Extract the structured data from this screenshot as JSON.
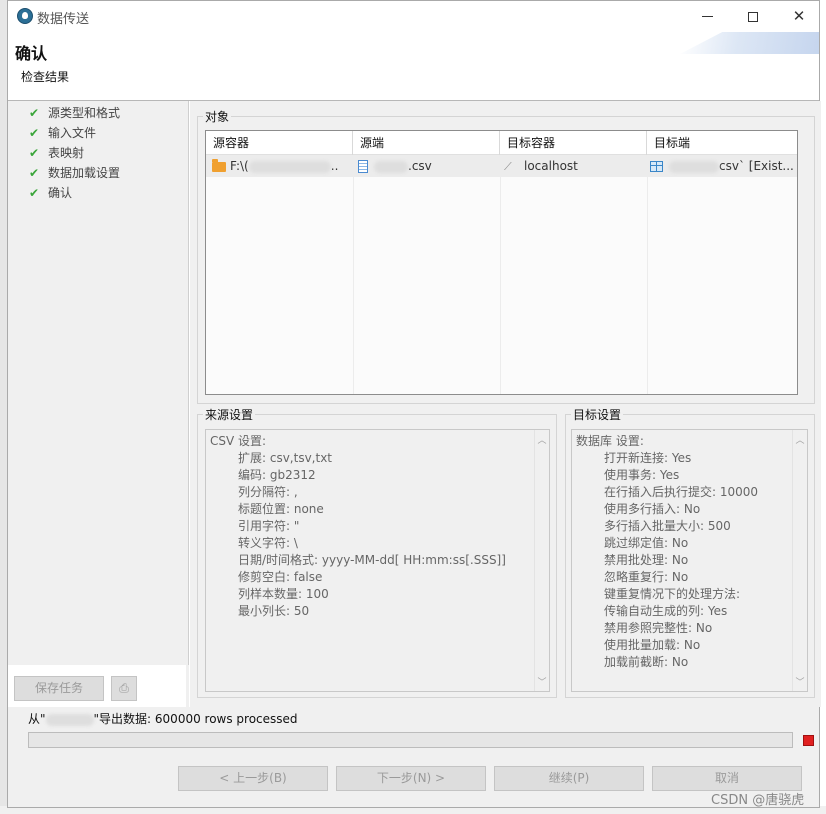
{
  "window": {
    "title": "数据传送",
    "minimize_icon": "minimize-icon",
    "maximize_icon": "maximize-icon",
    "close_icon": "close-icon"
  },
  "header": {
    "title": "确认",
    "description": "检查结果"
  },
  "steps": [
    {
      "label": "源类型和格式",
      "icon": "check-icon"
    },
    {
      "label": "输入文件",
      "icon": "check-icon"
    },
    {
      "label": "表映射",
      "icon": "check-icon"
    },
    {
      "label": "数据加载设置",
      "icon": "check-icon"
    },
    {
      "label": "确认",
      "icon": "check-icon"
    }
  ],
  "objects": {
    "group_label": "对象",
    "columns": [
      "源容器",
      "源端",
      "目标容器",
      "目标端"
    ],
    "row": {
      "source_container": "F:\\(",
      "source_container_suffix": "..",
      "source": ".csv",
      "target_container": "localhost",
      "target": "csv` [Exist..."
    }
  },
  "source_settings": {
    "group_label": "来源设置",
    "header": "CSV 设置:",
    "lines": [
      "扩展: csv,tsv,txt",
      "编码: gb2312",
      "列分隔符: ,",
      "标题位置: none",
      "引用字符: \"",
      "转义字符: \\",
      "日期/时间格式: yyyy-MM-dd[ HH:mm:ss[.SSS]]",
      "修剪空白: false",
      "列样本数量: 100",
      "最小列长: 50"
    ]
  },
  "target_settings": {
    "group_label": "目标设置",
    "header": "数据库 设置:",
    "lines": [
      "打开新连接: Yes",
      "使用事务: Yes",
      "在行插入后执行提交: 10000",
      "使用多行插入: No",
      "多行插入批量大小: 500",
      "跳过绑定值: No",
      "禁用批处理: No",
      "忽略重复行: No",
      "键重复情况下的处理方法:",
      "传输自动生成的列: Yes",
      "禁用参照完整性: No",
      "使用批量加载: No",
      "加载前截断: No"
    ]
  },
  "task": {
    "save_label": "保存任务",
    "print_icon": "print-icon"
  },
  "status": {
    "prefix": "从\"",
    "suffix": "\"导出数据:  600000 rows processed",
    "progress": 0
  },
  "buttons": {
    "back": "< 上一步(B)",
    "next": "下一步(N) >",
    "continue": "继续(P)",
    "cancel": "取消"
  },
  "watermark": "CSDN @唐骁虎"
}
